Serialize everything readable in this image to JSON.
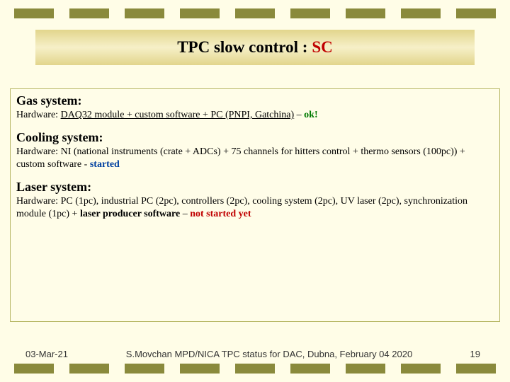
{
  "title": {
    "prefix": "TPC  slow control :",
    "suffix": "SC"
  },
  "sections": {
    "gas": {
      "title": "Gas system:",
      "hw_label": "Hardware:",
      "hw_body_u": "DAQ32 module + custom software + PC (PNPI, Gatchina)",
      "dash": " – ",
      "status": "ok!"
    },
    "cooling": {
      "title": "Cooling system:",
      "hw_label": "Hardware:",
      "hw_body": " NI (national instruments (crate + ADCs) + 75 channels for hitters control + thermo sensors (100pc)) + custom software",
      "dash": " - ",
      "status": "started"
    },
    "laser": {
      "title": "Laser system:",
      "hw_label": "Hardware:",
      "hw_body": " PC (1pc),  industrial PC (2pc), controllers (2pc), cooling system (2pc), UV laser (2pc), synchronization module (1pc) + ",
      "producer": "laser producer software",
      "dash": " – ",
      "status": "not started yet"
    }
  },
  "footer": {
    "date": "03-Mar-21",
    "caption": "S.Movchan  MPD/NICA TPC status for DAC, Dubna, February 04  2020",
    "pagenum": "19"
  }
}
